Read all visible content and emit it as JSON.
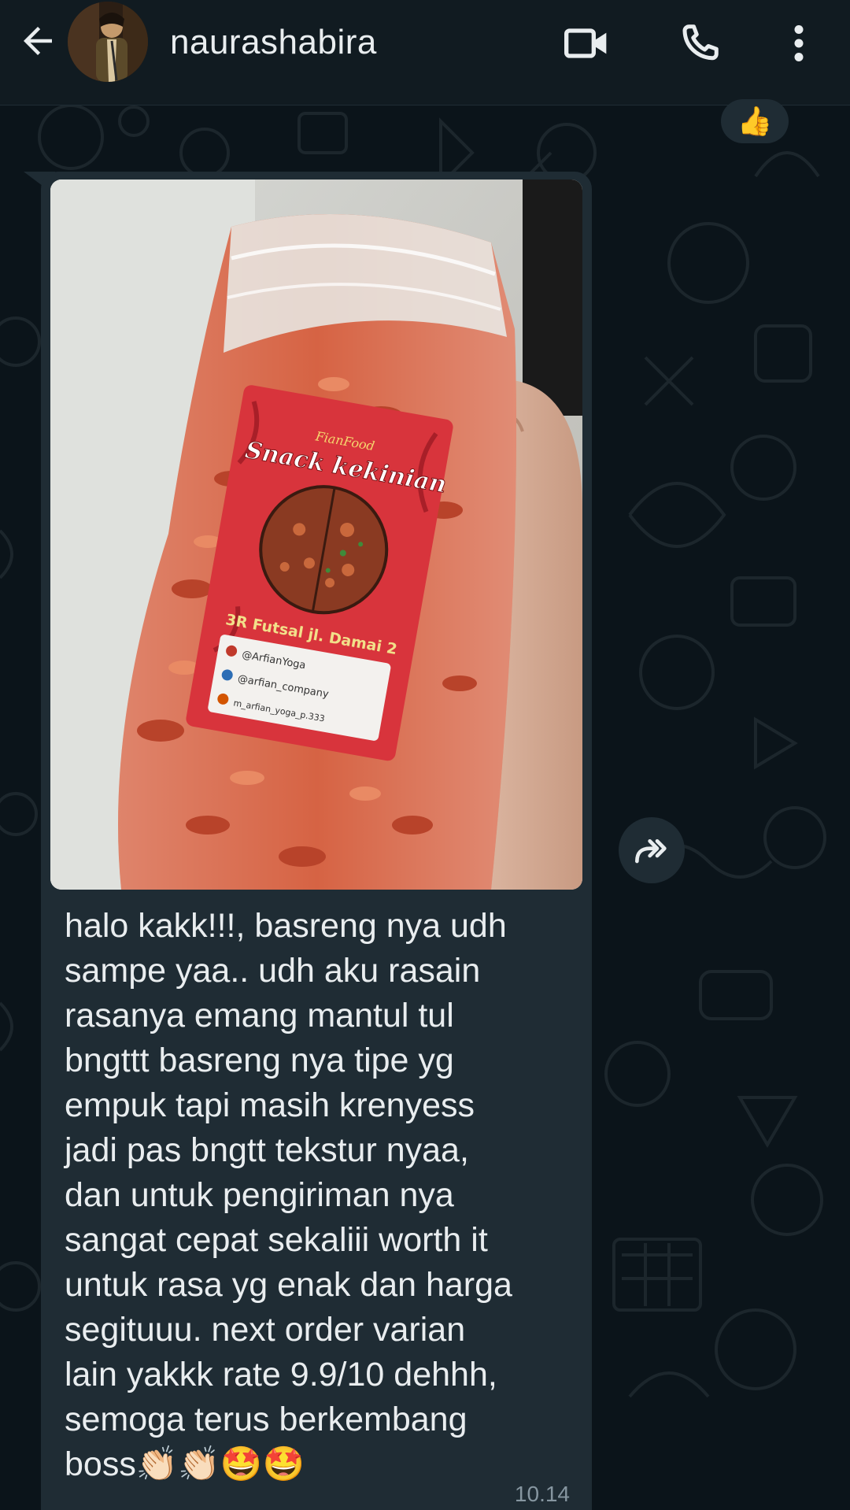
{
  "header": {
    "contact_name": "naurashabira"
  },
  "icons": {
    "back": "arrow-left-icon",
    "video": "video-camera-icon",
    "call": "phone-icon",
    "menu": "vertical-dots-icon",
    "forward": "forward-icon"
  },
  "prev_message": {
    "reaction": "👍"
  },
  "message": {
    "image_label_text": [
      "FianFood",
      "Snack kekinian",
      "3R Futsal jl. Damai 2",
      "@ArfianYoga",
      "@arfian_company",
      "m_arfian_yoga_p.333"
    ],
    "text": "halo kakk!!!, basreng nya udh\nsampe yaa.. udh aku rasain\nrasanya emang mantul tul\nbngttt basreng nya tipe yg\nempuk tapi masih krenyess\njadi pas bngtt tekstur nyaa,\ndan untuk pengiriman nya\nsangat cepat sekaliii worth it\nuntuk rasa yg enak dan harga\nsegituuu. next order varian\nlain yakkk rate 9.9/10 dehhh,\nsemoga terus berkembang\nboss👏🏻👏🏻🤩🤩",
    "time": "10.14"
  },
  "colors": {
    "background": "#0b141a",
    "header": "#111b21",
    "bubble": "#1f2c34",
    "text": "#e9edef",
    "meta": "#8696a0"
  }
}
